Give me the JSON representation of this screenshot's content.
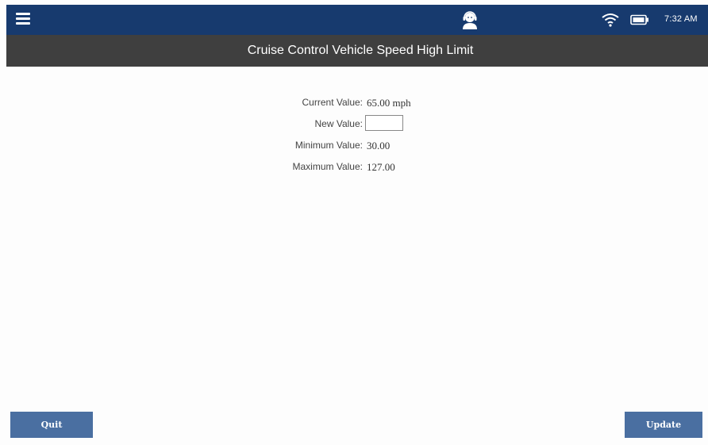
{
  "status_bar": {
    "time": "7:32 AM",
    "icons": [
      "menu-icon",
      "support-agent-icon",
      "wifi-icon",
      "battery-icon"
    ],
    "background_color": "#173a6e"
  },
  "title_bar": {
    "title": "Cruise Control Vehicle Speed High Limit",
    "background_color": "#3f3f3f"
  },
  "form": {
    "current_value_label": "Current Value:",
    "current_value": "65.00 mph",
    "new_value_label": "New Value:",
    "new_value": "",
    "minimum_value_label": "Minimum Value:",
    "minimum_value": "30.00",
    "maximum_value_label": "Maximum Value:",
    "maximum_value": "127.00"
  },
  "buttons": {
    "quit_label": "Quit",
    "update_label": "Update",
    "color": "#4a6fa1"
  }
}
